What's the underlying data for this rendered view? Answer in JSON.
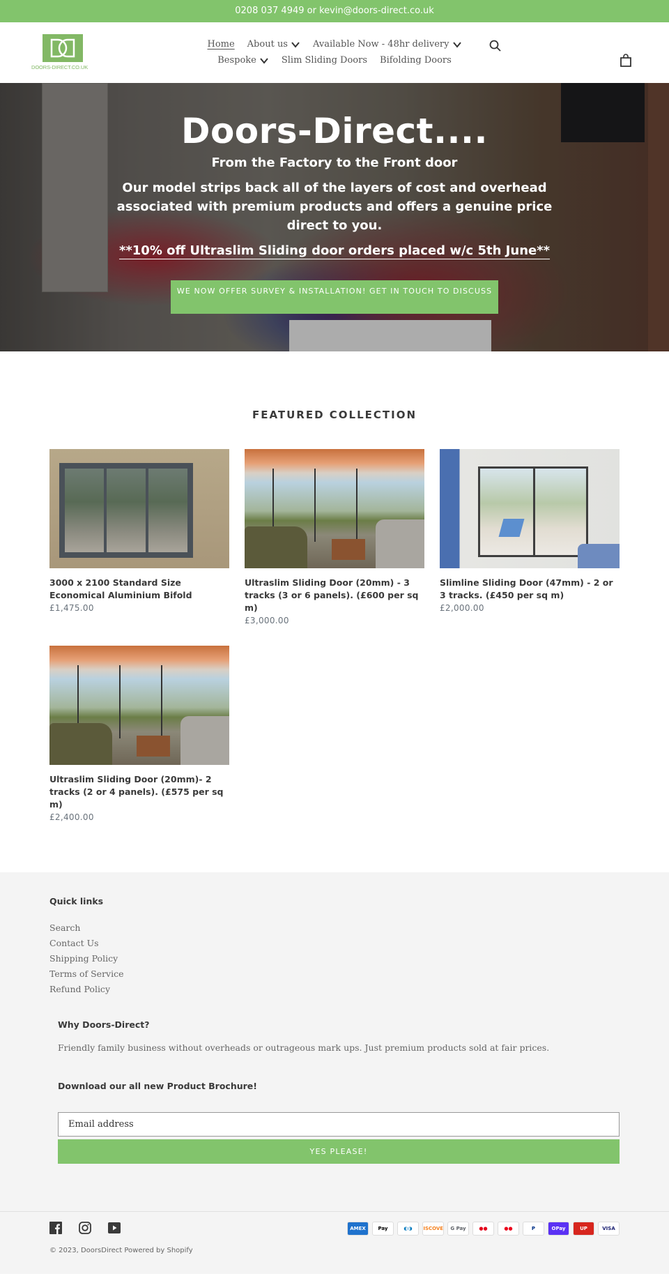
{
  "announcement": "0208 037 4949 or kevin@doors-direct.co.uk",
  "logo": {
    "text": "DOORS-DIRECT.CO.UK",
    "icon": "dd-logo-icon"
  },
  "nav": {
    "items": [
      {
        "label": "Home",
        "active": true,
        "dropdown": false
      },
      {
        "label": "About us",
        "dropdown": true
      },
      {
        "label": "Available Now - 48hr delivery",
        "dropdown": true
      },
      {
        "label": "Bespoke",
        "dropdown": true
      },
      {
        "label": "Slim Sliding Doors",
        "dropdown": false
      },
      {
        "label": "Bifolding Doors",
        "dropdown": false
      }
    ],
    "search_icon": "search-icon",
    "cart_icon": "shopping-bag-icon"
  },
  "hero": {
    "title": "Doors-Direct....",
    "subtitle": "From the Factory to the Front door",
    "text": "Our model strips back all of the layers of cost and overhead associated with premium products and offers a genuine price direct to you.",
    "promo": "**10% off Ultraslim Sliding door orders placed w/c 5th June**",
    "cta": "We now offer Survey & Installation! Get in touch to discuss"
  },
  "featured": {
    "title": "FEATURED COLLECTION",
    "products": [
      {
        "title": "3000 x 2100 Standard Size Economical Aluminium Bifold",
        "price": "£1,475.00"
      },
      {
        "title": "Ultraslim Sliding Door (20mm) - 3 tracks (3 or 6 panels). (£600 per sq m)",
        "price": "£3,000.00"
      },
      {
        "title": "Slimline Sliding Door (47mm) - 2 or 3 tracks. (£450 per sq m)",
        "price": "£2,000.00"
      },
      {
        "title": "Ultraslim Sliding Door (20mm)- 2 tracks (2 or 4 panels). (£575 per sq m)",
        "price": "£2,400.00"
      }
    ]
  },
  "footer": {
    "quick_links_title": "Quick links",
    "quick_links": [
      "Search",
      "Contact Us",
      "Shipping Policy",
      "Terms of Service",
      "Refund Policy"
    ],
    "why_title": "Why Doors-Direct?",
    "why_text": "Friendly family business without overheads or outrageous mark ups.  Just premium products sold at fair prices.",
    "brochure_title": "Download our all new Product Brochure!",
    "email_placeholder": "Email address",
    "submit_label": "YES PLEASE!",
    "social": [
      "facebook-icon",
      "instagram-icon",
      "youtube-icon"
    ],
    "payments": [
      {
        "name": "American Express",
        "label": "AMEX",
        "color": "#1f72cd",
        "fg": "#ffffff"
      },
      {
        "name": "Apple Pay",
        "label": " Pay",
        "color": "#ffffff",
        "fg": "#000000"
      },
      {
        "name": "Diners Club",
        "label": "◐◑",
        "color": "#ffffff",
        "fg": "#0079be"
      },
      {
        "name": "Discover",
        "label": "DISCOVER",
        "color": "#ffffff",
        "fg": "#f58220"
      },
      {
        "name": "Google Pay",
        "label": "G Pay",
        "color": "#ffffff",
        "fg": "#5f6368"
      },
      {
        "name": "Maestro",
        "label": "●●",
        "color": "#ffffff",
        "fg": "#e3001b"
      },
      {
        "name": "Mastercard",
        "label": "●●",
        "color": "#ffffff",
        "fg": "#eb001b"
      },
      {
        "name": "PayPal",
        "label": "P",
        "color": "#ffffff",
        "fg": "#003087"
      },
      {
        "name": "Shop Pay",
        "label": "OPay",
        "color": "#5a31f4",
        "fg": "#ffffff"
      },
      {
        "name": "Union Pay",
        "label": "UP",
        "color": "#d7261e",
        "fg": "#ffffff"
      },
      {
        "name": "Visa",
        "label": "VISA",
        "color": "#ffffff",
        "fg": "#1a1f71"
      }
    ],
    "copyright": "© 2023, DoorsDirect Powered by Shopify"
  },
  "colors": {
    "brand_green": "#82c46c",
    "footer_bg": "#f4f4f4",
    "text": "#3a3a3a"
  }
}
